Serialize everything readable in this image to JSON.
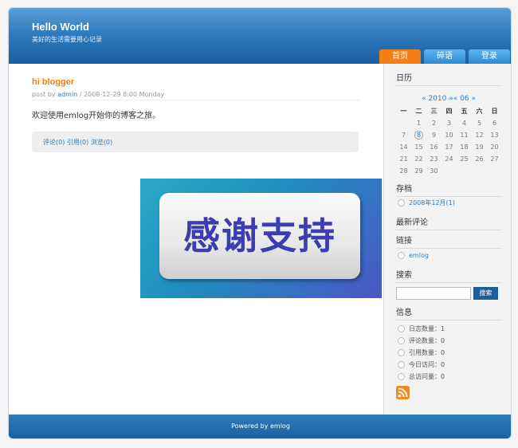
{
  "header": {
    "title": "Hello World",
    "subtitle": "美好的生活需要用心记录"
  },
  "nav": [
    {
      "label": "首页"
    },
    {
      "label": "碎语"
    },
    {
      "label": "登录"
    }
  ],
  "post": {
    "title": "hi blogger",
    "meta_prefix": "post by",
    "author": "admin",
    "meta_suffix": "/ 2008-12-29 8:00 Monday",
    "body": "欢迎使用emlog开始你的博客之旅。",
    "comments": "评论(0)",
    "trackbacks": "引用(0)",
    "views": "浏览(0)"
  },
  "banner": {
    "text": "感谢支持"
  },
  "sidebar": {
    "calendar_title": "日历",
    "calendar_nav": "« 2010 »« 06 »",
    "weekdays": [
      "一",
      "二",
      "三",
      "四",
      "五",
      "六",
      "日"
    ],
    "weeks": [
      [
        "",
        "1",
        "2",
        "3",
        "4",
        "5",
        "6"
      ],
      [
        "7",
        "8",
        "9",
        "10",
        "11",
        "12",
        "13"
      ],
      [
        "14",
        "15",
        "16",
        "17",
        "18",
        "19",
        "20"
      ],
      [
        "21",
        "22",
        "23",
        "24",
        "25",
        "26",
        "27"
      ],
      [
        "28",
        "29",
        "30",
        "",
        "",
        "",
        ""
      ]
    ],
    "archive_title": "存档",
    "archive_item": "2008年12月(1)",
    "comments_title": "最新评论",
    "links_title": "链接",
    "link_item": "emlog",
    "search_title": "搜索",
    "search_button": "搜索",
    "info_title": "信息",
    "info": [
      "日志数量：1",
      "评论数量：0",
      "引用数量：0",
      "今日访问：0",
      "总访问量：0"
    ]
  },
  "footer": {
    "text": "Powered by emlog"
  },
  "colors": {
    "accent": "#f57f17",
    "brand_blue": "#2e7cbf"
  }
}
